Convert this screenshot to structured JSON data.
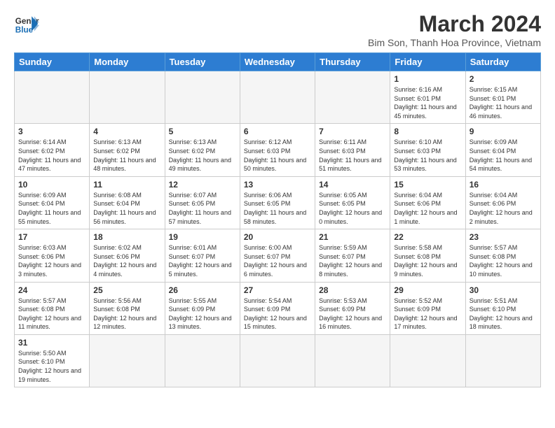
{
  "header": {
    "logo_general": "General",
    "logo_blue": "Blue",
    "month_title": "March 2024",
    "subtitle": "Bim Son, Thanh Hoa Province, Vietnam"
  },
  "weekdays": [
    "Sunday",
    "Monday",
    "Tuesday",
    "Wednesday",
    "Thursday",
    "Friday",
    "Saturday"
  ],
  "weeks": [
    [
      {
        "day": "",
        "info": ""
      },
      {
        "day": "",
        "info": ""
      },
      {
        "day": "",
        "info": ""
      },
      {
        "day": "",
        "info": ""
      },
      {
        "day": "",
        "info": ""
      },
      {
        "day": "1",
        "info": "Sunrise: 6:16 AM\nSunset: 6:01 PM\nDaylight: 11 hours and 45 minutes."
      },
      {
        "day": "2",
        "info": "Sunrise: 6:15 AM\nSunset: 6:01 PM\nDaylight: 11 hours and 46 minutes."
      }
    ],
    [
      {
        "day": "3",
        "info": "Sunrise: 6:14 AM\nSunset: 6:02 PM\nDaylight: 11 hours and 47 minutes."
      },
      {
        "day": "4",
        "info": "Sunrise: 6:13 AM\nSunset: 6:02 PM\nDaylight: 11 hours and 48 minutes."
      },
      {
        "day": "5",
        "info": "Sunrise: 6:13 AM\nSunset: 6:02 PM\nDaylight: 11 hours and 49 minutes."
      },
      {
        "day": "6",
        "info": "Sunrise: 6:12 AM\nSunset: 6:03 PM\nDaylight: 11 hours and 50 minutes."
      },
      {
        "day": "7",
        "info": "Sunrise: 6:11 AM\nSunset: 6:03 PM\nDaylight: 11 hours and 51 minutes."
      },
      {
        "day": "8",
        "info": "Sunrise: 6:10 AM\nSunset: 6:03 PM\nDaylight: 11 hours and 53 minutes."
      },
      {
        "day": "9",
        "info": "Sunrise: 6:09 AM\nSunset: 6:04 PM\nDaylight: 11 hours and 54 minutes."
      }
    ],
    [
      {
        "day": "10",
        "info": "Sunrise: 6:09 AM\nSunset: 6:04 PM\nDaylight: 11 hours and 55 minutes."
      },
      {
        "day": "11",
        "info": "Sunrise: 6:08 AM\nSunset: 6:04 PM\nDaylight: 11 hours and 56 minutes."
      },
      {
        "day": "12",
        "info": "Sunrise: 6:07 AM\nSunset: 6:05 PM\nDaylight: 11 hours and 57 minutes."
      },
      {
        "day": "13",
        "info": "Sunrise: 6:06 AM\nSunset: 6:05 PM\nDaylight: 11 hours and 58 minutes."
      },
      {
        "day": "14",
        "info": "Sunrise: 6:05 AM\nSunset: 6:05 PM\nDaylight: 12 hours and 0 minutes."
      },
      {
        "day": "15",
        "info": "Sunrise: 6:04 AM\nSunset: 6:06 PM\nDaylight: 12 hours and 1 minute."
      },
      {
        "day": "16",
        "info": "Sunrise: 6:04 AM\nSunset: 6:06 PM\nDaylight: 12 hours and 2 minutes."
      }
    ],
    [
      {
        "day": "17",
        "info": "Sunrise: 6:03 AM\nSunset: 6:06 PM\nDaylight: 12 hours and 3 minutes."
      },
      {
        "day": "18",
        "info": "Sunrise: 6:02 AM\nSunset: 6:06 PM\nDaylight: 12 hours and 4 minutes."
      },
      {
        "day": "19",
        "info": "Sunrise: 6:01 AM\nSunset: 6:07 PM\nDaylight: 12 hours and 5 minutes."
      },
      {
        "day": "20",
        "info": "Sunrise: 6:00 AM\nSunset: 6:07 PM\nDaylight: 12 hours and 6 minutes."
      },
      {
        "day": "21",
        "info": "Sunrise: 5:59 AM\nSunset: 6:07 PM\nDaylight: 12 hours and 8 minutes."
      },
      {
        "day": "22",
        "info": "Sunrise: 5:58 AM\nSunset: 6:08 PM\nDaylight: 12 hours and 9 minutes."
      },
      {
        "day": "23",
        "info": "Sunrise: 5:57 AM\nSunset: 6:08 PM\nDaylight: 12 hours and 10 minutes."
      }
    ],
    [
      {
        "day": "24",
        "info": "Sunrise: 5:57 AM\nSunset: 6:08 PM\nDaylight: 12 hours and 11 minutes."
      },
      {
        "day": "25",
        "info": "Sunrise: 5:56 AM\nSunset: 6:08 PM\nDaylight: 12 hours and 12 minutes."
      },
      {
        "day": "26",
        "info": "Sunrise: 5:55 AM\nSunset: 6:09 PM\nDaylight: 12 hours and 13 minutes."
      },
      {
        "day": "27",
        "info": "Sunrise: 5:54 AM\nSunset: 6:09 PM\nDaylight: 12 hours and 15 minutes."
      },
      {
        "day": "28",
        "info": "Sunrise: 5:53 AM\nSunset: 6:09 PM\nDaylight: 12 hours and 16 minutes."
      },
      {
        "day": "29",
        "info": "Sunrise: 5:52 AM\nSunset: 6:09 PM\nDaylight: 12 hours and 17 minutes."
      },
      {
        "day": "30",
        "info": "Sunrise: 5:51 AM\nSunset: 6:10 PM\nDaylight: 12 hours and 18 minutes."
      }
    ],
    [
      {
        "day": "31",
        "info": "Sunrise: 5:50 AM\nSunset: 6:10 PM\nDaylight: 12 hours and 19 minutes."
      },
      {
        "day": "",
        "info": ""
      },
      {
        "day": "",
        "info": ""
      },
      {
        "day": "",
        "info": ""
      },
      {
        "day": "",
        "info": ""
      },
      {
        "day": "",
        "info": ""
      },
      {
        "day": "",
        "info": ""
      }
    ]
  ]
}
